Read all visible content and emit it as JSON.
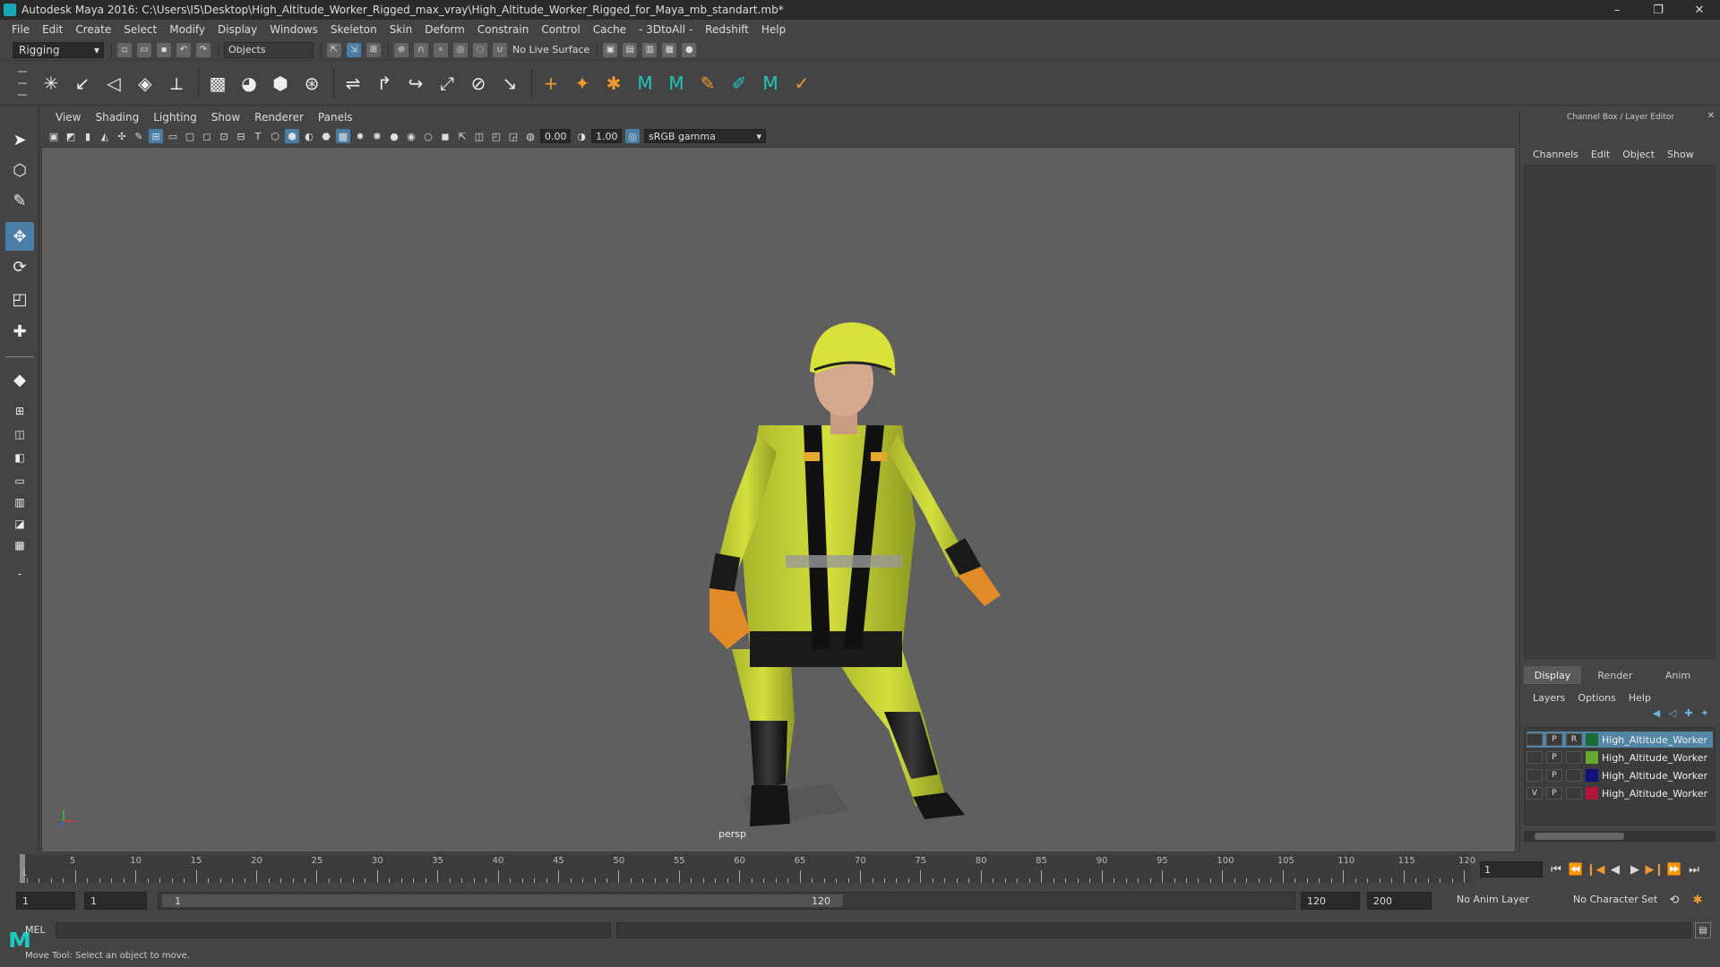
{
  "window": {
    "title": "Autodesk Maya 2016: C:\\Users\\I5\\Desktop\\High_Altitude_Worker_Rigged_max_vray\\High_Altitude_Worker_Rigged_for_Maya_mb_standart.mb*",
    "minimize": "–",
    "maximize": "❐",
    "close": "✕"
  },
  "menubar": [
    "File",
    "Edit",
    "Create",
    "Select",
    "Modify",
    "Display",
    "Windows",
    "Skeleton",
    "Skin",
    "Deform",
    "Constrain",
    "Control",
    "Cache",
    "- 3DtoAll -",
    "Redshift",
    "Help"
  ],
  "statusline": {
    "mode": "Rigging",
    "selection_mask": "Objects",
    "live_surface": "No Live Surface"
  },
  "viewport": {
    "menus": [
      "View",
      "Shading",
      "Lighting",
      "Show",
      "Renderer",
      "Panels"
    ],
    "exposure": "0.00",
    "gamma": "1.00",
    "color_space": "sRGB gamma",
    "camera_label": "persp"
  },
  "channelbox": {
    "title": "Channel Box / Layer Editor",
    "menus": [
      "Channels",
      "Edit",
      "Object",
      "Show"
    ]
  },
  "layer_editor": {
    "tabs": [
      "Display",
      "Render",
      "Anim"
    ],
    "active_tab": "Display",
    "menus": [
      "Layers",
      "Options",
      "Help"
    ],
    "layers": [
      {
        "name": "High_Altitude_Worker",
        "v": "",
        "p": "P",
        "r": "R",
        "color": "#1e6b3a",
        "selected": true
      },
      {
        "name": "High_Altitude_Worker",
        "v": "",
        "p": "P",
        "r": "",
        "color": "#6aa82e",
        "selected": false
      },
      {
        "name": "High_Altitude_Worker",
        "v": "",
        "p": "P",
        "r": "",
        "color": "#12127a",
        "selected": false
      },
      {
        "name": "High_Altitude_Worker",
        "v": "V",
        "p": "P",
        "r": "",
        "color": "#b0153a",
        "selected": false
      }
    ]
  },
  "timeline": {
    "ticks": [
      "5",
      "10",
      "15",
      "20",
      "25",
      "30",
      "35",
      "40",
      "45",
      "50",
      "55",
      "60",
      "65",
      "70",
      "75",
      "80",
      "85",
      "90",
      "95",
      "100",
      "105",
      "110",
      "115",
      "120"
    ],
    "first_frame": "1",
    "current_frame": "1"
  },
  "range": {
    "start_time": "1",
    "playback_start": "1",
    "range_start_label": "1",
    "range_end_label": "120",
    "playback_end": "120",
    "end_time": "200",
    "anim_layer": "No Anim Layer",
    "character_set": "No Character Set"
  },
  "cmdline": {
    "label": "MEL"
  },
  "helpline": {
    "text": "Move Tool: Select an object to move."
  },
  "icons": {
    "select_tool": "select-arrow-icon",
    "lasso_tool": "lasso-icon",
    "paint_tool": "paint-brush-icon",
    "move_tool": "move-icon",
    "rotate_tool": "rotate-icon",
    "scale_tool": "scale-icon"
  }
}
